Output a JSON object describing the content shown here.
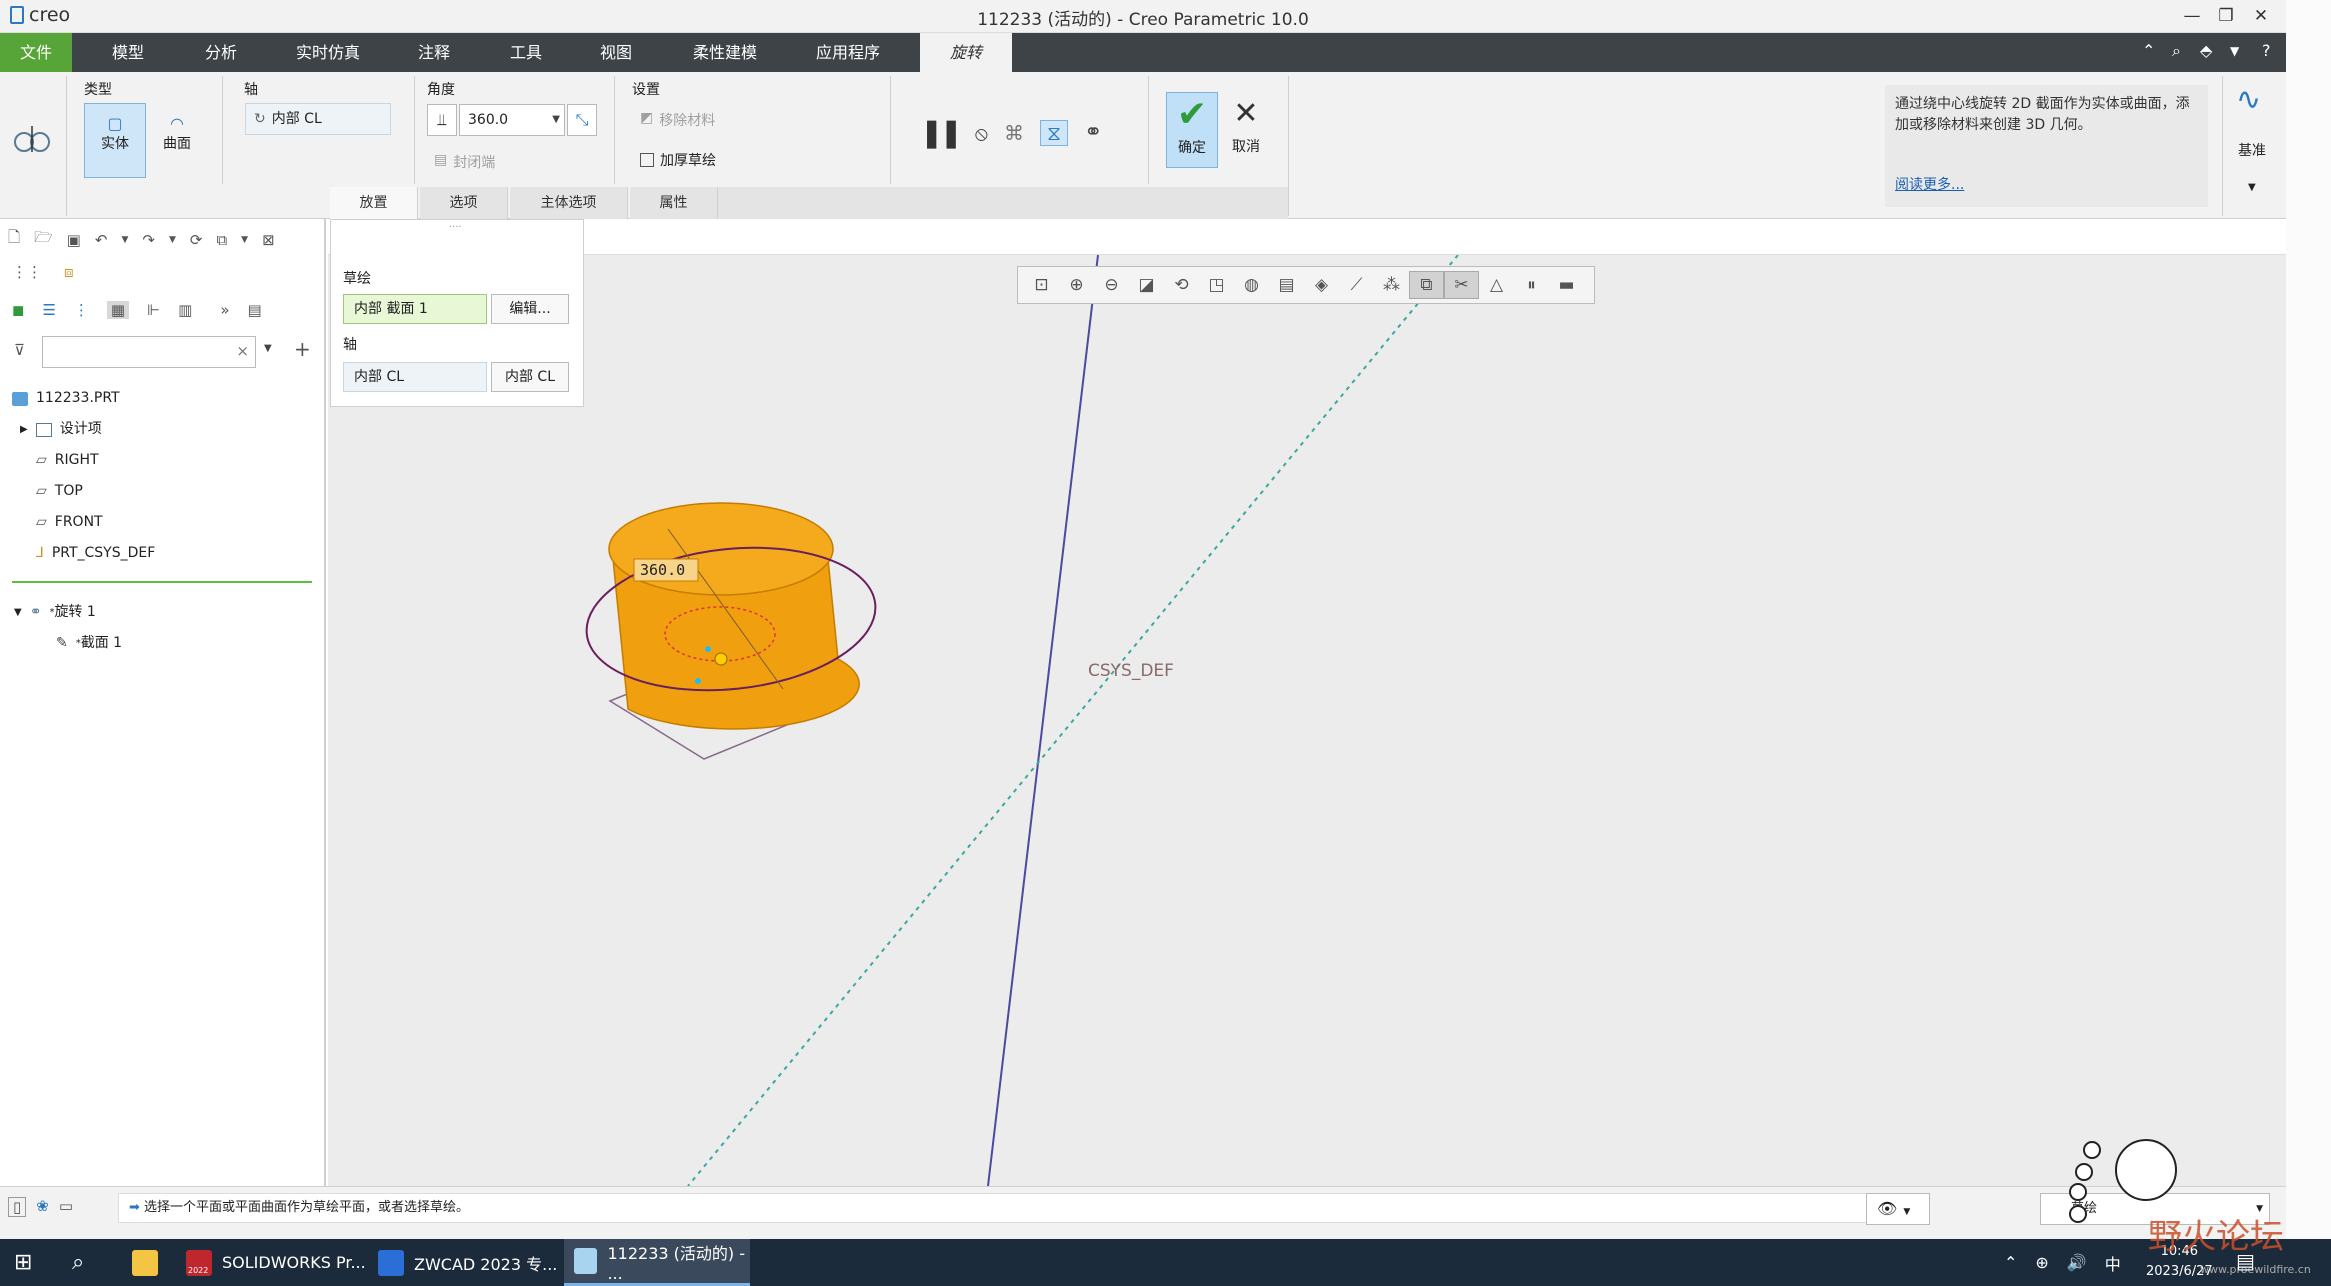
{
  "app": {
    "logo": "creo",
    "window_title": "112233 (活动的) - Creo Parametric 10.0"
  },
  "window_controls": {
    "minimize": "—",
    "restore": "❐",
    "close": "✕"
  },
  "menu": {
    "items": [
      "文件",
      "模型",
      "分析",
      "实时仿真",
      "注释",
      "工具",
      "视图",
      "柔性建模",
      "应用程序"
    ],
    "active_tab": "旋转"
  },
  "ribbon": {
    "type_label": "类型",
    "solid_label": "实体",
    "surface_label": "曲面",
    "axis_label": "轴",
    "axis_value": "内部 CL",
    "angle_label": "角度",
    "angle_value": "360.0",
    "closed_ends": "封闭端",
    "settings_label": "设置",
    "remove_material": "移除材料",
    "thicken_sketch": "加厚草绘",
    "ok_label": "确定",
    "cancel_label": "取消",
    "datum_label": "基准",
    "subtabs": [
      "放置",
      "选项",
      "主体选项",
      "属性"
    ]
  },
  "help": {
    "text": "通过绕中心线旋转 2D 截面作为实体或曲面，添加或移除材料来创建 3D 几何。",
    "link": "阅读更多..."
  },
  "placement": {
    "sketch_label": "草绘",
    "sketch_value": "内部 截面 1",
    "edit_button": "编辑...",
    "axis_label": "轴",
    "axis_value": "内部 CL",
    "axis_button": "内部 CL"
  },
  "tree": {
    "root": "112233.PRT",
    "items": [
      "设计项",
      "RIGHT",
      "TOP",
      "FRONT",
      "PRT_CSYS_DEF"
    ],
    "feature": "旋转 1",
    "feature_child": "截面 1",
    "new_marker": "*"
  },
  "viewport": {
    "angle_dim": "360.0",
    "csys_label": "CSYS_DEF"
  },
  "statusbar": {
    "message": "选择一个平面或平面曲面作为草绘平面，或者选择草绘。",
    "filter_partial": "草绘"
  },
  "taskbar": {
    "apps": [
      "SOLIDWORKS Pr...",
      "ZWCAD 2023 专...",
      "112233 (活动的) - ..."
    ],
    "sw_badge": "2022",
    "ime": "中",
    "time": "10:46",
    "date": "2023/6/27",
    "watermark": "野火论坛",
    "watermark_url": "www.proewildfire.cn"
  },
  "colors": {
    "menubar": "#3d4346",
    "file_tab": "#57a538",
    "accent_blue": "#2b79c2",
    "model_orange": "#f39c12",
    "ok_check": "#2e9a3c"
  }
}
